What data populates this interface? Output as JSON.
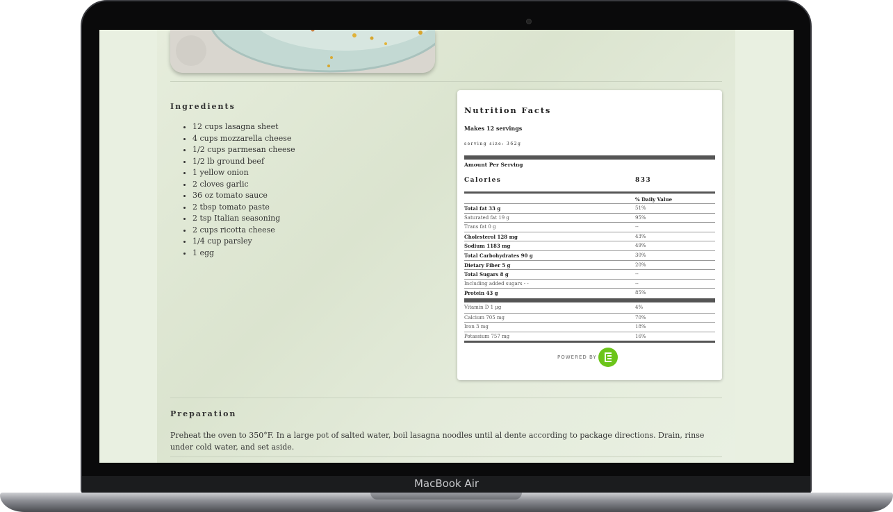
{
  "device": {
    "model_label": "MacBook Air"
  },
  "ingredients": {
    "title": "Ingredients",
    "items": [
      "12 cups lasagna sheet",
      "4 cups mozzarella cheese",
      "1/2 cups parmesan cheese",
      "1/2 lb ground beef",
      "1 yellow onion",
      "2 cloves garlic",
      "36 oz tomato sauce",
      "2 tbsp tomato paste",
      "2 tsp Italian seasoning",
      "2 cups ricotta cheese",
      "1/4 cup parsley",
      "1 egg"
    ]
  },
  "nutrition": {
    "title": "Nutrition Facts",
    "makes": "Makes 12 servings",
    "serving_size": "serving size: 362g",
    "amount_per_serving": "Amount Per Serving",
    "calories_label": "Calories",
    "calories_value": "833",
    "dv_header": "% Daily Value",
    "rows": [
      {
        "name": "Total fat 33 g",
        "pct": "51%",
        "bold": true
      },
      {
        "name": "Saturated fat 19 g",
        "pct": "95%",
        "bold": false
      },
      {
        "name": "Trans fat 0 g",
        "pct": "--",
        "bold": false
      },
      {
        "name": "Cholesterol 128 mg",
        "pct": "43%",
        "bold": true
      },
      {
        "name": "Sodium 1183 mg",
        "pct": "49%",
        "bold": true
      },
      {
        "name": "Total Carbohydrates 90 g",
        "pct": "30%",
        "bold": true
      },
      {
        "name": "Dietary Fiber 5 g",
        "pct": "20%",
        "bold": true
      },
      {
        "name": "Total Sugars 8 g",
        "pct": "--",
        "bold": true
      },
      {
        "name": "Including added sugars - -",
        "pct": "--",
        "bold": false
      },
      {
        "name": "Protein 43 g",
        "pct": "85%",
        "bold": true
      }
    ],
    "micros": [
      {
        "name": "Vitamin D 1 µg",
        "pct": "4%"
      },
      {
        "name": "Calcium 705 mg",
        "pct": "70%"
      },
      {
        "name": "Iron 3 mg",
        "pct": "18%"
      },
      {
        "name": "Potassium 757 mg",
        "pct": "16%"
      }
    ],
    "powered_by": "POWERED BY",
    "logo_icon": "edamam-logo-icon"
  },
  "preparation": {
    "title": "Preparation",
    "text": "Preheat the oven to 350°F. In a large pot of salted water, boil lasagna noodles until al dente according to package directions. Drain, rinse under cold water, and set aside."
  },
  "colors": {
    "accent_green": "#6cc51a",
    "page_bg": "#e6eddc",
    "bar": "#555555"
  }
}
